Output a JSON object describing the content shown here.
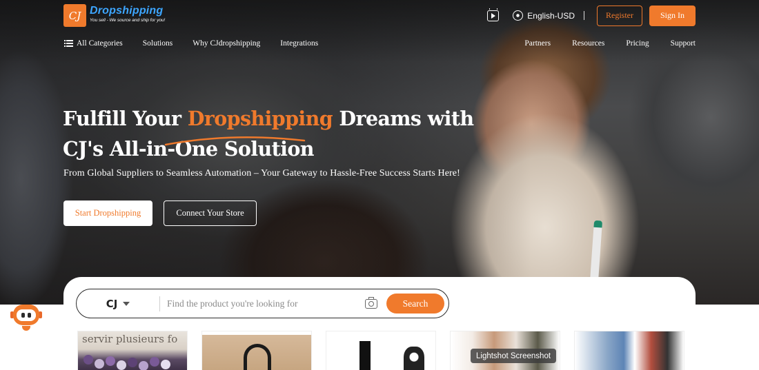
{
  "brand": {
    "mark": "CJ",
    "name": "Dropshipping",
    "tagline": "You sell - We source and ship for you!"
  },
  "header": {
    "language": "English-USD",
    "register_label": "Register",
    "signin_label": "Sign In"
  },
  "nav": {
    "left": [
      "All Categories",
      "Solutions",
      "Why CJdropshipping",
      "Integrations"
    ],
    "right": [
      "Partners",
      "Resources",
      "Pricing",
      "Support"
    ]
  },
  "hero": {
    "headline_part1": "Fulfill Your ",
    "headline_accent": "Dropshipping",
    "headline_part2": " Dreams with",
    "headline_line2": "CJ's All-in-One Solution",
    "subtitle": "From Global Suppliers to Seamless Automation – Your Gateway to Hassle-Free Success Starts Here!",
    "start_label": "Start Dropshipping",
    "connect_label": "Connect Your Store"
  },
  "search": {
    "scope": "CJ",
    "placeholder": "Find the product you're looking for",
    "button_label": "Search"
  },
  "products": {
    "thumb1_text": "servir plusieurs fo"
  },
  "overlay": {
    "tooltip": "Lightshot Screenshot"
  },
  "colors": {
    "accent": "#f07a2c",
    "logo_blue": "#3da6ff"
  },
  "icons": [
    "video-tutorial-icon",
    "globe-icon",
    "menu-icon",
    "camera-icon",
    "chevron-down-icon",
    "robot-assistant-icon"
  ]
}
